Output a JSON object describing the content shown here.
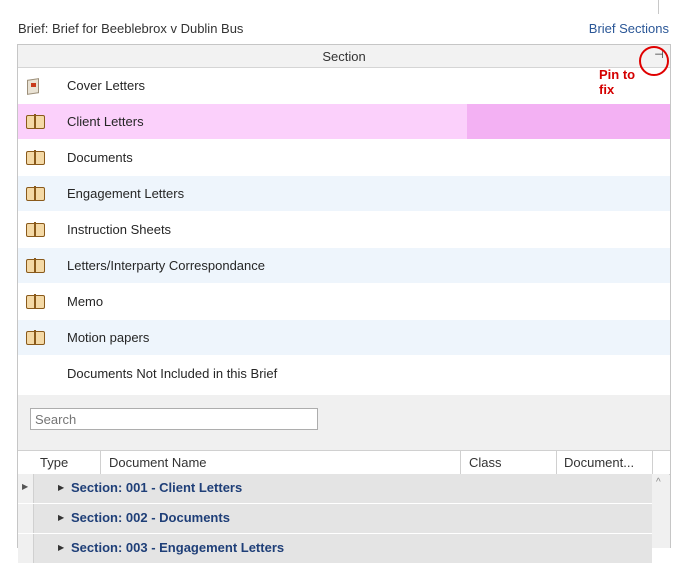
{
  "header": {
    "brief_title": "Brief: Brief for Beeblebrox v Dublin Bus",
    "brief_sections_link": "Brief Sections"
  },
  "sections_panel": {
    "column_header": "Section",
    "pin_glyph": "⊣",
    "pin_note": "Pin to fix",
    "rows": [
      {
        "label": "Cover Letters",
        "icon": "letter-icon"
      },
      {
        "label": "Client Letters",
        "icon": "book-icon",
        "selected": true
      },
      {
        "label": "Documents",
        "icon": "book-icon"
      },
      {
        "label": "Engagement Letters",
        "icon": "book-icon"
      },
      {
        "label": "Instruction Sheets",
        "icon": "book-icon"
      },
      {
        "label": "Letters/Interparty Correspondance",
        "icon": "book-icon"
      },
      {
        "label": "Memo",
        "icon": "book-icon"
      },
      {
        "label": "Motion papers",
        "icon": "book-icon"
      },
      {
        "label": "Documents Not Included in this Brief",
        "icon": ""
      }
    ]
  },
  "documents_panel": {
    "search_placeholder": "Search",
    "columns": {
      "type": "Type",
      "name": "Document Name",
      "class": "Class",
      "document": "Document..."
    },
    "groups": [
      "Section: 001 - Client Letters",
      "Section: 002 - Documents",
      "Section: 003 - Engagement Letters"
    ]
  },
  "colors": {
    "selected_row": "#fbd0fb",
    "selected_cell": "#f3b1f3",
    "annotation_red": "#d40000",
    "link_blue": "#2b5797"
  }
}
